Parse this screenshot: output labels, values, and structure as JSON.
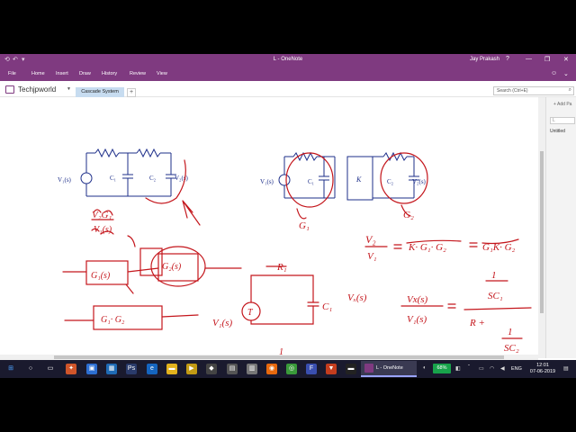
{
  "window": {
    "title": "L - OneNote",
    "user": "Jay Prakash",
    "controls": [
      "?",
      "—",
      "❐",
      "✕"
    ]
  },
  "ribbon": {
    "tabs": [
      "File",
      "Home",
      "Insert",
      "Draw",
      "History",
      "Review",
      "View"
    ]
  },
  "notebook": {
    "name": "Techjpworld",
    "section": "Cascade System",
    "add_section": "+"
  },
  "search": {
    "placeholder": "Search (Ctrl+E)"
  },
  "pages_pane": {
    "add_page": "+ Add Pa",
    "search_value": "L",
    "page_title": "Untitled"
  },
  "taskbar": {
    "onenote_label": "L - OneNote",
    "battery": "68%",
    "language": "ENG",
    "time": "12:01",
    "date": "07-06-2019"
  },
  "colors": {
    "accent": "#7f3a80",
    "ink": "#c4161c",
    "circuit": "#1e2f8a"
  },
  "notes": {
    "circuit_left": {
      "vin": "V₁(s)",
      "c1": "C₁",
      "c2": "C₂",
      "vout": "V₂(s)"
    },
    "circuit_right": {
      "vin": "V₁(s)",
      "c1": "C₁",
      "k": "K",
      "c2": "C₂",
      "vout": "V₂(s)"
    }
  }
}
